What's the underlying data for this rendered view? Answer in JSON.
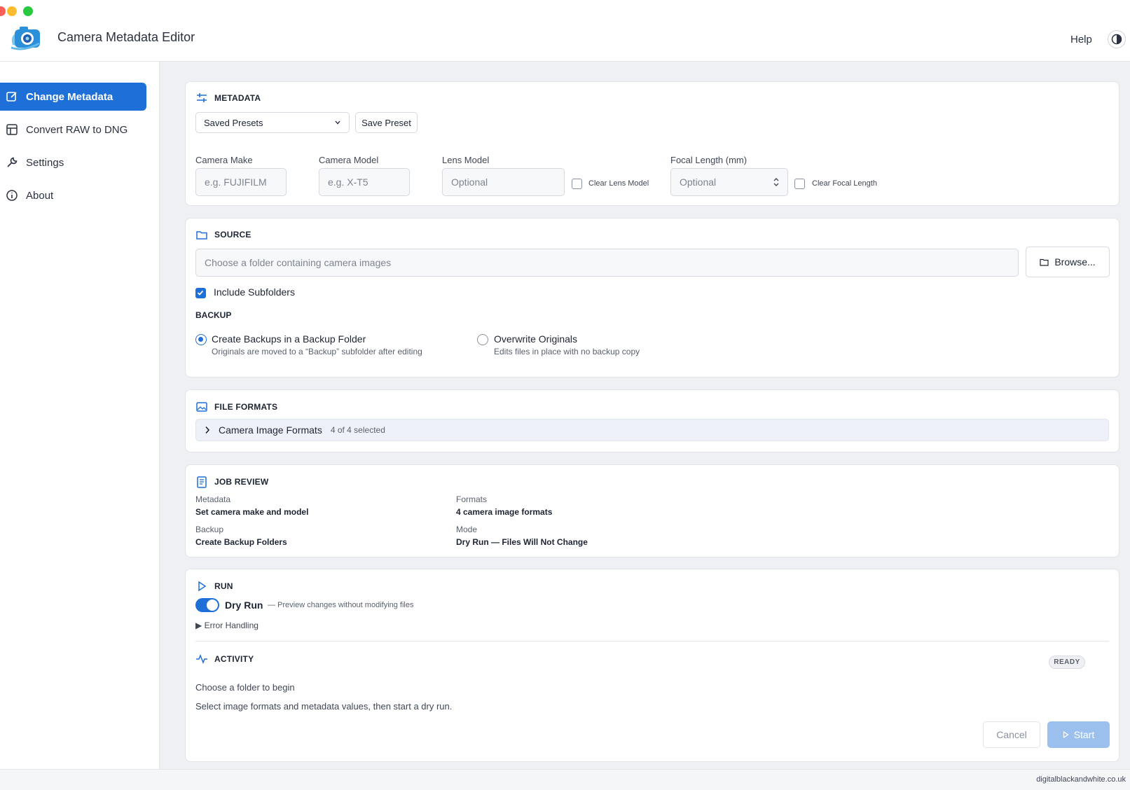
{
  "app": {
    "title": "Camera Metadata Editor",
    "help_label": "Help"
  },
  "colors": {
    "accent": "#1f6fd9",
    "background": "#eef0f3"
  },
  "sidebar": {
    "items": [
      {
        "label": "Change Metadata",
        "icon": "edit-icon",
        "active": true
      },
      {
        "label": "Convert RAW to DNG",
        "icon": "table-icon",
        "active": false
      },
      {
        "label": "Settings",
        "icon": "wrench-icon",
        "active": false
      },
      {
        "label": "About",
        "icon": "info-icon",
        "active": false
      }
    ]
  },
  "metadata": {
    "heading": "METADATA",
    "presets_label": "Saved Presets",
    "save_preset_label": "Save Preset",
    "camera_make": {
      "label": "Camera Make",
      "placeholder": "e.g. FUJIFILM"
    },
    "camera_model": {
      "label": "Camera Model",
      "placeholder": "e.g. X-T5"
    },
    "lens_model": {
      "label": "Lens Model",
      "placeholder": "Optional",
      "clear_label": "Clear Lens Model"
    },
    "focal_length": {
      "label": "Focal Length (mm)",
      "placeholder": "Optional",
      "clear_label": "Clear Focal Length"
    }
  },
  "source": {
    "heading": "SOURCE",
    "folder_placeholder": "Choose a folder containing camera images",
    "browse_label": "Browse...",
    "include_subfolders_label": "Include Subfolders",
    "include_subfolders_checked": true,
    "backup_heading": "BACKUP",
    "options": [
      {
        "title": "Create Backups in a Backup Folder",
        "description": "Originals are moved to a “Backup” subfolder after editing",
        "selected": true
      },
      {
        "title": "Overwrite Originals",
        "description": "Edits files in place with no backup copy",
        "selected": false
      }
    ]
  },
  "file_formats": {
    "heading": "FILE FORMATS",
    "group_label": "Camera Image Formats",
    "group_count": "4 of 4 selected"
  },
  "job_review": {
    "heading": "JOB REVIEW",
    "items": [
      {
        "label": "Metadata",
        "value": "Set camera make and model"
      },
      {
        "label": "Formats",
        "value": "4 camera image formats"
      },
      {
        "label": "Backup",
        "value": "Create Backup Folders"
      },
      {
        "label": "Mode",
        "value": "Dry Run — Files Will Not Change"
      }
    ]
  },
  "run": {
    "heading": "RUN",
    "dry_run_label": "Dry Run",
    "dry_run_enabled": true,
    "dry_run_desc": "— Preview changes without modifying files",
    "error_handling_label": "▶ Error Handling"
  },
  "activity": {
    "heading": "ACTIVITY",
    "status": "READY",
    "message_title": "Choose a folder to begin",
    "message_body": "Select image formats and metadata values, then start a dry run.",
    "cancel_label": "Cancel",
    "start_label": "Start"
  },
  "footer": {
    "text": "digitalblackandwhite.co.uk"
  }
}
